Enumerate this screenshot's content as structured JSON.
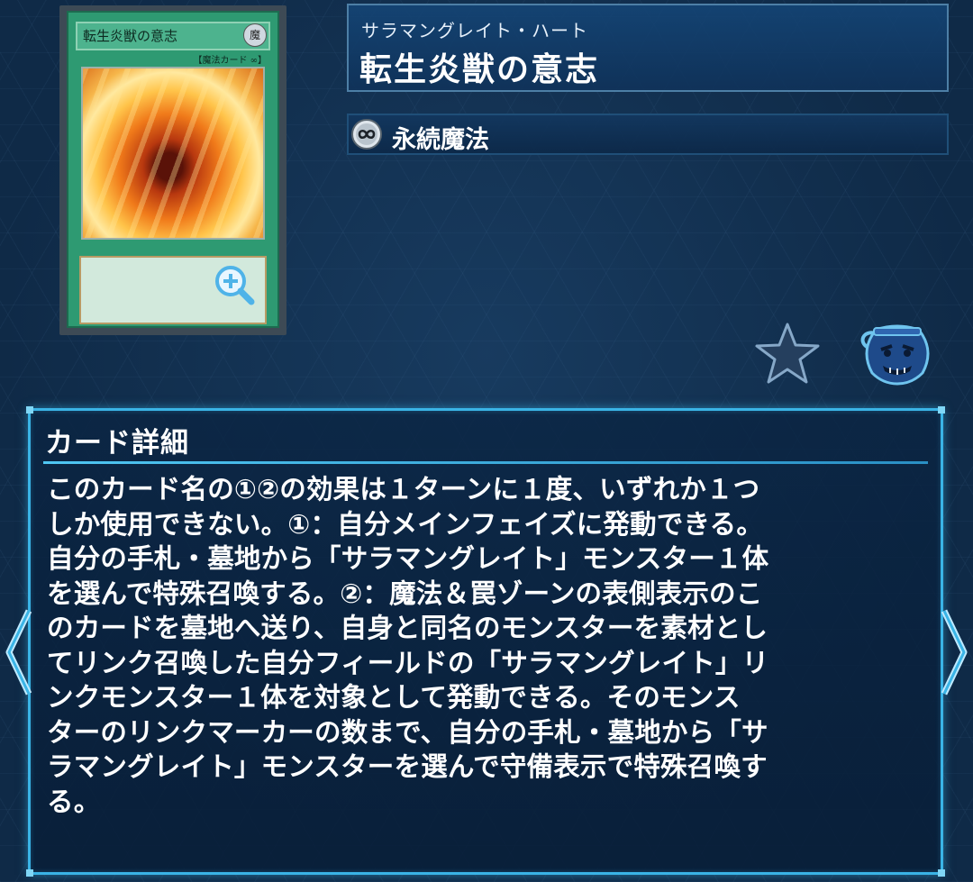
{
  "card": {
    "thumbnail": {
      "name_text": "転生炎獣の意志",
      "type_line": "【魔法カード ∞】",
      "zoom_icon": "zoom-in-icon"
    },
    "ruby": "サラマングレイト・ハート",
    "name": "転生炎獣の意志",
    "type_icon": "continuous-spell-icon",
    "type_label": "永続魔法"
  },
  "actions": {
    "favorite_icon": "star-icon",
    "deck_pot_icon": "pot-of-greed-icon"
  },
  "detail": {
    "heading": "カード詳細",
    "text": "このカード名の①②の効果は１ターンに１度、いずれか１つ\nしか使用できない。①：自分メインフェイズに発動できる。\n自分の手札・墓地から「サラマングレイト」モンスター１体\nを選んで特殊召喚する。②：魔法＆罠ゾーンの表側表示のこ\nのカードを墓地へ送り、自身と同名のモンスターを素材とし\nてリンク召喚した自分フィールドの「サラマングレイト」リ\nンクモンスター１体を対象として発動できる。そのモンス\nターのリンクマーカーの数まで、自分の手札・墓地から「サ\nラマングレイト」モンスターを選んで守備表示で特殊召喚す\nる。"
  },
  "navigation": {
    "prev_icon": "chevron-left-icon",
    "next_icon": "chevron-right-icon"
  },
  "colors": {
    "spell_green": "#2e9a72",
    "accent_cyan": "#3ab4e6",
    "background": "#0f2a47"
  }
}
